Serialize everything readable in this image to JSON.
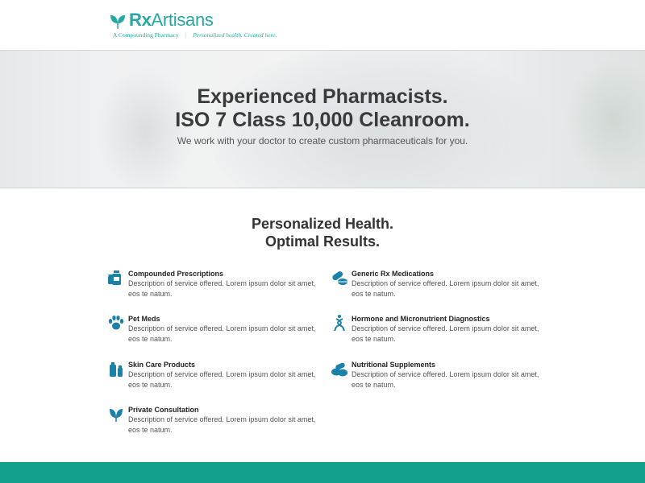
{
  "header": {
    "brand_rx": "Rx",
    "brand_name": "Artisans",
    "tagline_left": "A Compounding Pharmacy",
    "tagline_separator": "|",
    "tagline_right": "Personalized health. Created here."
  },
  "hero": {
    "title_line1": "Experienced Pharmacists.",
    "title_line2": "ISO 7 Class 10,000 Cleanroom.",
    "subtitle": "We work with your doctor to create custom pharmaceuticals for you."
  },
  "services": {
    "title_line1": "Personalized Health.",
    "title_line2": "Optimal Results.",
    "items": [
      {
        "title": "Compounded Prescriptions",
        "desc": "Description of service offered. Lorem ipsum dolor sit amet, eos te natum.",
        "icon": "prescription-bottles-icon"
      },
      {
        "title": "Generic Rx Medications",
        "desc": "Description of service offered. Lorem ipsum dolor sit amet, eos te natum.",
        "icon": "pills-icon"
      },
      {
        "title": "Pet Meds",
        "desc": "Description of service offered. Lorem ipsum dolor sit amet, eos te natum.",
        "icon": "paw-icon"
      },
      {
        "title": "Hormone and Micronutrient Diagnostics",
        "desc": "Description of service offered. Lorem ipsum dolor sit amet, eos te natum.",
        "icon": "dna-icon"
      },
      {
        "title": "Skin Care Products",
        "desc": "Description of service offered. Lorem ipsum dolor sit amet, eos te natum.",
        "icon": "skincare-bottle-icon"
      },
      {
        "title": "Nutritional Supplements",
        "desc": "Description of service offered. Lorem ipsum dolor sit amet, eos te natum.",
        "icon": "supplements-icon"
      },
      {
        "title": "Private Consultation",
        "desc": "Description of service offered. Lorem ipsum dolor sit amet, eos te natum.",
        "icon": "leaf-icon"
      }
    ]
  },
  "colors": {
    "brand": "#25a8a1",
    "icon": "#1a82a8",
    "footer": "#129f8b"
  }
}
